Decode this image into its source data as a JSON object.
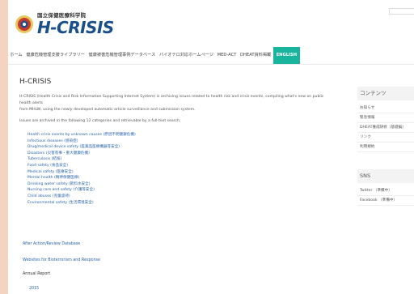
{
  "header": {
    "institution": "国立保健医療科学院",
    "wordmark": "H-CRISIS"
  },
  "nav": {
    "items": [
      {
        "label": "ホーム",
        "active": false
      },
      {
        "label": "健康危機管理支援ライブラリー",
        "active": false
      },
      {
        "label": "健康被害危機管理事例データベース",
        "active": false
      },
      {
        "label": "バイオテロ対応ホームページ",
        "active": false
      },
      {
        "label": "MED-ACT",
        "active": false
      },
      {
        "label": "DHEAT資料掲載",
        "active": false
      },
      {
        "label": "ENGLISH",
        "active": true
      }
    ]
  },
  "main": {
    "title": "H-CRISIS",
    "intro_line1": "H-CRISIS (Health Crisis and Risk Information Supporting Internet System) is archiving issues related to health risk and crisis events, compiling what's new on public health alerts",
    "intro_line2": "from MHLW, using the newly developed automatic article surveillance and submission system.",
    "categories_intro": "Issues are archived in the following 12 categories and retrievable by a full-text search.",
    "categories": [
      "Health crisis events by unknown causes (原因不明健康危機)",
      "Infectious diseases (感染症)",
      "Drug/medical device safety (医薬品医療機器等安全)",
      "Disasters (災害有事・重大健康危機)",
      "Tuberculosis (結核)",
      "Food safety (食品安全)",
      "Medical safety (医療安全)",
      "Mental health (精神保健医療)",
      "Drinking water safety (飲料水安全)",
      "Nursing care and safety (介護等安全)",
      "Child abuses (児童虐待)",
      "Environmental safety (生活環境安全)"
    ],
    "aar_link": "After Action/Review Database",
    "ws_link": "Websites for Bioterrorism and Response",
    "annual_report": "Annual Report",
    "year_link": "2015"
  },
  "sidebar": {
    "contents_heading": "コンテンツ",
    "contents_items": [
      "お知らせ",
      "緊急情報",
      "DHEAT養成研修（基礎編）",
      "リンク",
      "利用規約"
    ],
    "sns_heading": "SNS",
    "sns_items": [
      "Twitter （準備中）",
      "Facebook （準備中）"
    ]
  },
  "colors": {
    "accent": "#19b49d",
    "link": "#2a64a9",
    "brand": "#1a4f8a",
    "backdrop": "#f4d3c2"
  }
}
